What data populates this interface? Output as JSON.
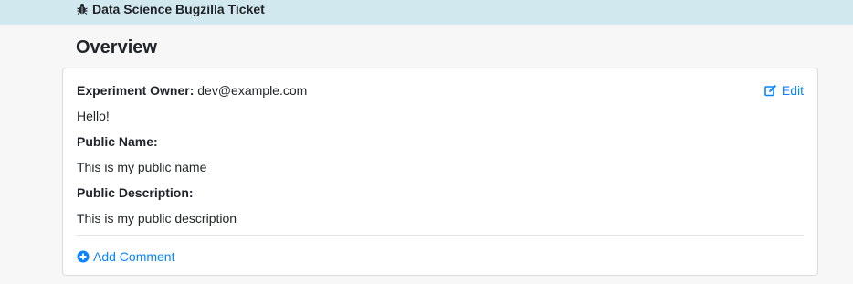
{
  "header": {
    "link_label": "Data Science Bugzilla Ticket",
    "icon": "bug-icon"
  },
  "page": {
    "title": "Overview"
  },
  "card": {
    "owner_label": "Experiment Owner:",
    "owner_value": "dev@example.com",
    "edit_label": "Edit",
    "edit_icon": "edit-icon",
    "message": "Hello!",
    "public_name_label": "Public Name:",
    "public_name_value": "This is my public name",
    "public_description_label": "Public Description:",
    "public_description_value": "This is my public description",
    "add_comment_label": "Add Comment",
    "add_comment_icon": "plus-circle-icon"
  },
  "colors": {
    "header_bg": "#d1e8ef",
    "link": "#0a84ff"
  }
}
